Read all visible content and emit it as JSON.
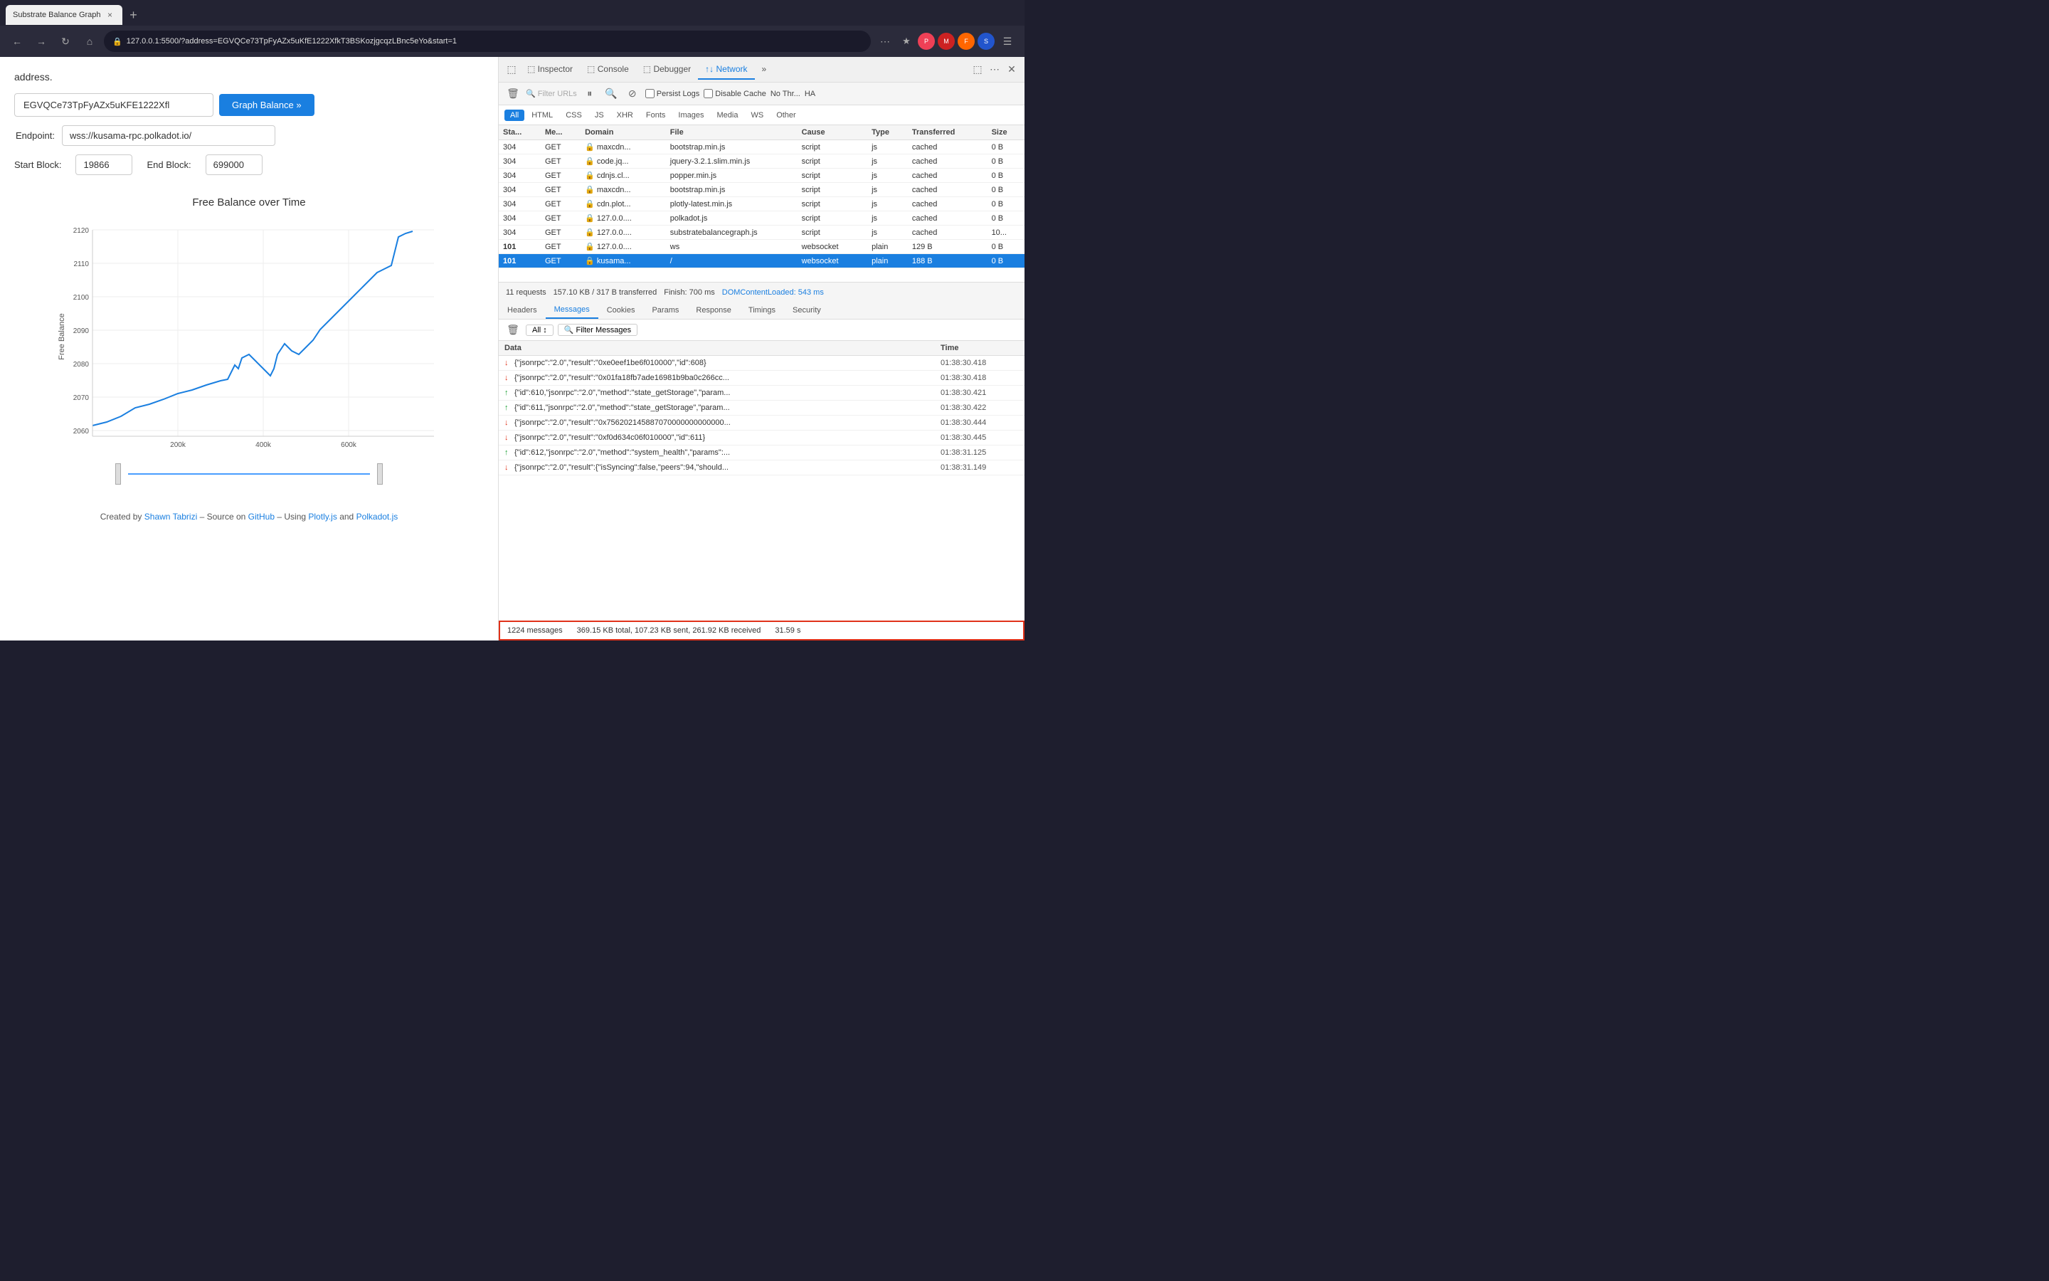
{
  "browser": {
    "tab_title": "Substrate Balance Graph",
    "url": "127.0.0.1:5500/?address=EGVQCe73TpFyAZx5uKfE1222XfkT3BSKozjgcqzLBnc5eYo&start=1",
    "close_icon": "×",
    "new_tab_icon": "+"
  },
  "page": {
    "intro_text": "address.",
    "address_placeholder": "EGVQCe73TpFyAZx5uKFE1222Xfl",
    "graph_button": "Graph Balance »",
    "endpoint_label": "Endpoint:",
    "endpoint_value": "wss://kusama-rpc.polkadot.io/",
    "start_block_label": "Start Block:",
    "start_block_value": "19866",
    "end_block_label": "End Block:",
    "end_block_value": "699000",
    "chart_title": "Free Balance over Time",
    "y_label": "Free Balance",
    "y_values": [
      "2060",
      "2070",
      "2080",
      "2090",
      "2100",
      "2110",
      "2120"
    ],
    "x_values": [
      "200k",
      "400k",
      "600k"
    ],
    "footer": "Created by",
    "author": "Shawn Tabrizi",
    "dash": "– Source on",
    "github": "GitHub",
    "using": "– Using",
    "plotly": "Plotly.js",
    "and": "and",
    "polkadot": "Polkadot.js"
  },
  "devtools": {
    "title": "Network",
    "tabs": [
      "Inspector",
      "Console",
      "Debugger",
      "Network"
    ],
    "toolbar_btns": [
      "🗑",
      "⏸",
      "🔍",
      "⊘"
    ],
    "filter_placeholder": "Filter URLs",
    "persist_logs": "Persist Logs",
    "disable_cache": "Disable Cache",
    "throttle": "No Thr...",
    "ha": "HA",
    "filter_types": [
      "All",
      "HTML",
      "CSS",
      "JS",
      "XHR",
      "Fonts",
      "Images",
      "Media",
      "WS",
      "Other"
    ],
    "table_headers": [
      "Sta...",
      "Me...",
      "Domain",
      "File",
      "Cause",
      "Type",
      "Transferred",
      "Size"
    ],
    "rows": [
      {
        "status": "304",
        "method": "GET",
        "domain": "maxcdn...",
        "file": "bootstrap.min.js",
        "cause": "script",
        "type": "js",
        "transferred": "cached",
        "size": "0 B"
      },
      {
        "status": "304",
        "method": "GET",
        "domain": "code.jq...",
        "file": "jquery-3.2.1.slim.min.js",
        "cause": "script",
        "type": "js",
        "transferred": "cached",
        "size": "0 B"
      },
      {
        "status": "304",
        "method": "GET",
        "domain": "cdnjs.cl...",
        "file": "popper.min.js",
        "cause": "script",
        "type": "js",
        "transferred": "cached",
        "size": "0 B"
      },
      {
        "status": "304",
        "method": "GET",
        "domain": "maxcdn...",
        "file": "bootstrap.min.js",
        "cause": "script",
        "type": "js",
        "transferred": "cached",
        "size": "0 B"
      },
      {
        "status": "304",
        "method": "GET",
        "domain": "cdn.plot...",
        "file": "plotly-latest.min.js",
        "cause": "script",
        "type": "js",
        "transferred": "cached",
        "size": "0 B"
      },
      {
        "status": "304",
        "method": "GET",
        "domain": "127.0.0....",
        "file": "polkadot.js",
        "cause": "script",
        "type": "js",
        "transferred": "cached",
        "size": "0 B"
      },
      {
        "status": "304",
        "method": "GET",
        "domain": "127.0.0....",
        "file": "substratebalancegraph.js",
        "cause": "script",
        "type": "js",
        "transferred": "cached",
        "size": "10..."
      },
      {
        "status": "101",
        "method": "GET",
        "domain": "127.0.0....",
        "file": "ws",
        "cause": "websocket",
        "type": "plain",
        "transferred": "129 B",
        "size": "0 B"
      },
      {
        "status": "101",
        "method": "GET",
        "domain": "kusama...",
        "file": "/",
        "cause": "websocket",
        "type": "plain",
        "transferred": "188 B",
        "size": "0 B",
        "selected": true
      }
    ],
    "status_bar": {
      "requests": "11 requests",
      "transferred": "157.10 KB / 317 B transferred",
      "finish": "Finish: 700 ms",
      "dom_loaded": "DOMContentLoaded: 543 ms"
    },
    "sub_tabs": [
      "Headers",
      "Messages",
      "Cookies",
      "Params",
      "Response",
      "Timings",
      "Security"
    ],
    "messages_toolbar": {
      "all_btn": "All ↕",
      "filter_btn": "Filter Messages"
    },
    "messages_header": {
      "data": "Data",
      "time": "Time"
    },
    "messages": [
      {
        "direction": "down",
        "data": "{\"jsonrpc\":\"2.0\",\"result\":\"0xe0eef1be6f010000\",\"id\":608}",
        "time": "01:38:30.418"
      },
      {
        "direction": "down",
        "data": "{\"jsonrpc\":\"2.0\",\"result\":\"0x01fa18fb7ade16981b9ba0c266cc...",
        "time": "01:38:30.418"
      },
      {
        "direction": "up",
        "data": "{\"id\":610,\"jsonrpc\":\"2.0\",\"method\":\"state_getStorage\",\"param...",
        "time": "01:38:30.421"
      },
      {
        "direction": "up",
        "data": "{\"id\":611,\"jsonrpc\":\"2.0\",\"method\":\"state_getStorage\",\"param...",
        "time": "01:38:30.422"
      },
      {
        "direction": "down",
        "data": "{\"jsonrpc\":\"2.0\",\"result\":\"0x756202145887070000000000000...",
        "time": "01:38:30.444"
      },
      {
        "direction": "down",
        "data": "{\"jsonrpc\":\"2.0\",\"result\":\"0xf0d634c06f010000\",\"id\":611}",
        "time": "01:38:30.445"
      },
      {
        "direction": "up",
        "data": "{\"id\":612,\"jsonrpc\":\"2.0\",\"method\":\"system_health\",\"params\":...",
        "time": "01:38:31.125"
      },
      {
        "direction": "down",
        "data": "{\"jsonrpc\":\"2.0\",\"result\":{\"isSyncing\":false,\"peers\":94,\"should...",
        "time": "01:38:31.149"
      }
    ],
    "footer": {
      "messages_count": "1224 messages",
      "total": "369.15 KB total, 107.23 KB sent, 261.92 KB received",
      "duration": "31.59 s"
    }
  }
}
